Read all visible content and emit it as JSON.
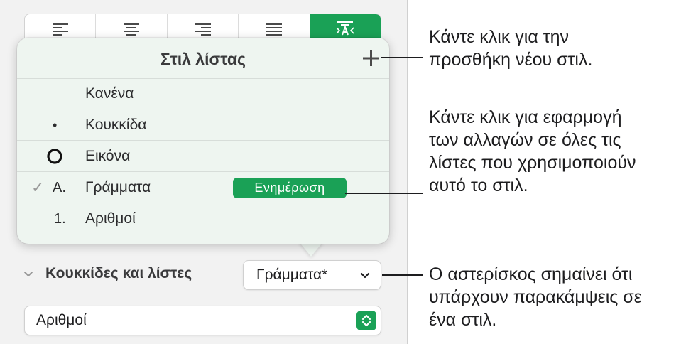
{
  "popover": {
    "title": "Στιλ λίστας",
    "rows": [
      {
        "marker": "",
        "label": "Κανένα"
      },
      {
        "marker": "•",
        "label": "Κουκκίδα"
      },
      {
        "marker": "",
        "label": "Εικόνα"
      },
      {
        "marker": "A.",
        "label": "Γράμματα",
        "check": "✓"
      },
      {
        "marker": "1.",
        "label": "Αριθμοί"
      }
    ],
    "update_label": "Ενημέρωση"
  },
  "bullets": {
    "section_label": "Κουκκίδες και λίστες",
    "style_value": "Γράμματα*",
    "type_value": "Αριθμοί"
  },
  "callouts": {
    "plus": "Κάντε κλικ για την\nπροσθήκη νέου στιλ.",
    "update": "Κάντε κλικ για εφαρμογή\nτων αλλαγών σε όλες τις\nλίστες που χρησιμοποιούν\nαυτό το στιλ.",
    "asterisk": "Ο αστερίσκος σημαίνει ότι\nυπάρχουν παρακάμψεις σε\nένα στιλ."
  },
  "colors": {
    "accent": "#1aa156",
    "popover_bg": "#eef5f0",
    "panel_bg": "#f2f2f2"
  },
  "icons": {
    "align": [
      "align-left-icon",
      "align-center-icon",
      "align-right-icon",
      "justify-icon",
      "text-fit-icon"
    ],
    "plus": "plus-icon",
    "chevron": "chevron-down-icon",
    "stepper": "up-down-stepper-icon"
  }
}
